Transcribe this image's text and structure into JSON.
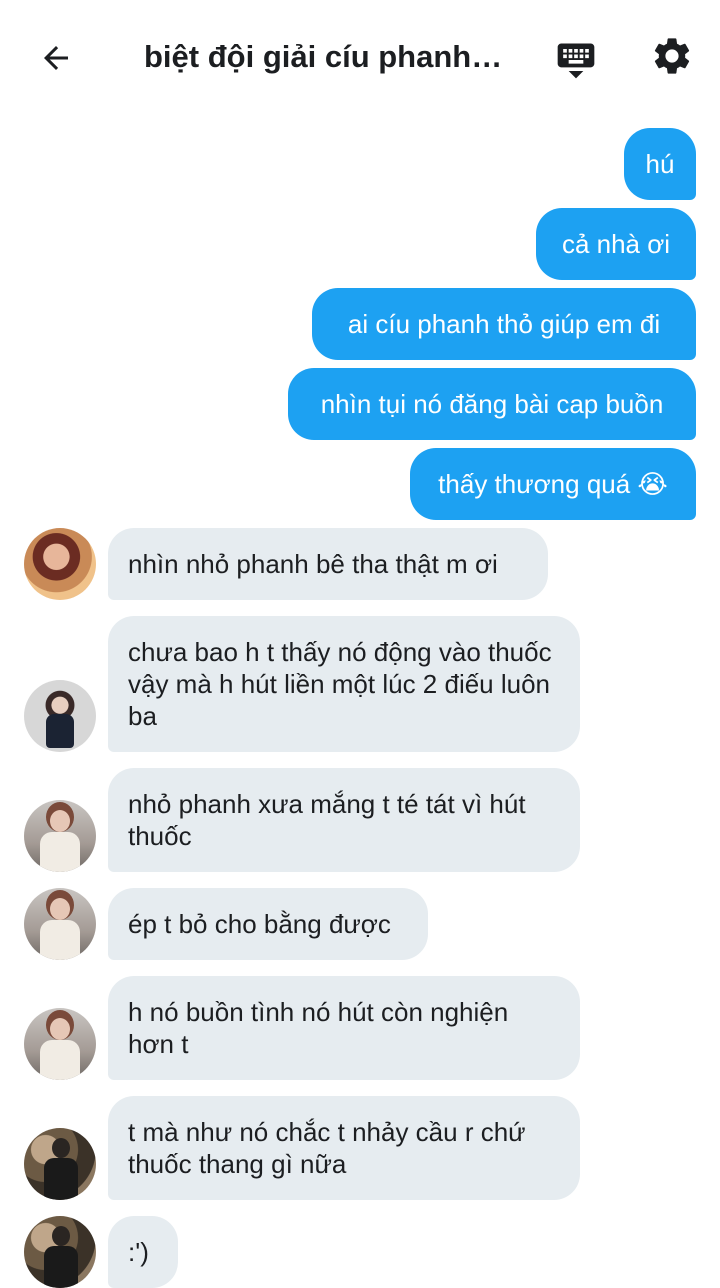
{
  "header": {
    "title": "biệt đội giải cíu phanh ..."
  },
  "icons": {
    "back": "arrow-left-icon",
    "keyboard": "keyboard-icon",
    "settings": "gear-icon"
  },
  "colors": {
    "outgoing_bubble": "#1da1f2",
    "incoming_bubble": "#e6ecf0"
  },
  "messages": [
    {
      "dir": "out",
      "text": "hú"
    },
    {
      "dir": "out",
      "text": "cả nhà ơi"
    },
    {
      "dir": "out",
      "text": "ai cíu phanh thỏ giúp em đi"
    },
    {
      "dir": "out",
      "text": "nhìn tụi nó đăng bài cap buồn"
    },
    {
      "dir": "out",
      "text": "thấy thương quá 😭"
    },
    {
      "dir": "in",
      "text": "nhìn nhỏ phanh bê tha thật m ơi"
    },
    {
      "dir": "in",
      "text": "chưa bao h t thấy nó động vào thuốc vậy mà h hút liền một lúc 2 điếu luôn ba"
    },
    {
      "dir": "in",
      "text": "nhỏ phanh xưa mắng t té tát vì hút thuốc"
    },
    {
      "dir": "in",
      "text": "ép t bỏ cho bằng được"
    },
    {
      "dir": "in",
      "text": "h nó buồn tình nó hút còn nghiện hơn t"
    },
    {
      "dir": "in",
      "text": "t mà như nó chắc t nhảy cầu r chứ thuốc thang gì nữa"
    },
    {
      "dir": "in",
      "text": ":')"
    }
  ]
}
